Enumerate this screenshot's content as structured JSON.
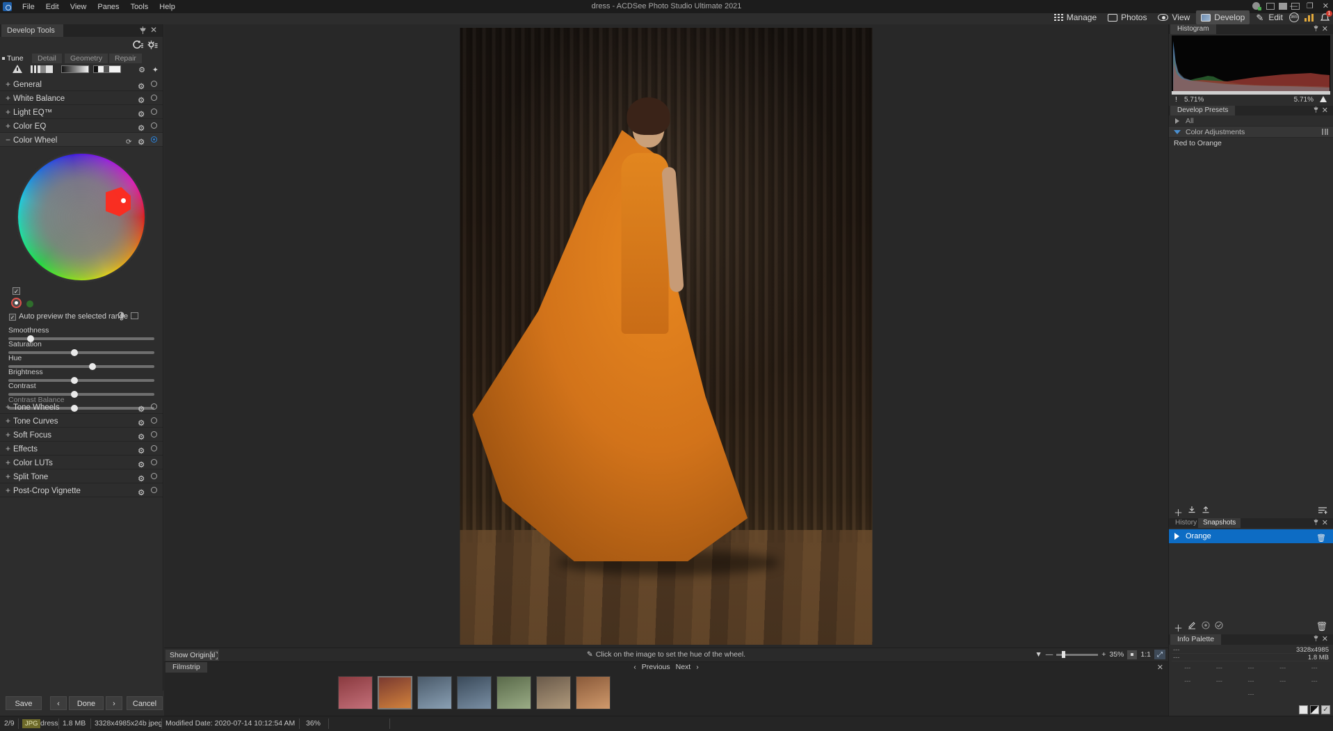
{
  "window": {
    "title": "dress - ACDSee Photo Studio Ultimate 2021",
    "minimize": "—",
    "maximize": "❐",
    "close": "✕"
  },
  "menu": {
    "items": [
      "File",
      "Edit",
      "View",
      "Panes",
      "Tools",
      "Help"
    ]
  },
  "modes": [
    {
      "label": "Manage",
      "icon": "grid-icon",
      "active": false
    },
    {
      "label": "Photos",
      "icon": "photos-icon",
      "active": false
    },
    {
      "label": "View",
      "icon": "eye-icon",
      "active": false
    },
    {
      "label": "Develop",
      "icon": "develop-icon",
      "active": true
    },
    {
      "label": "Edit",
      "icon": "edit-icon",
      "active": false
    }
  ],
  "mode_extras": {
    "badge_365": "365",
    "notifications": "1"
  },
  "left_panel": {
    "title": "Develop Tools",
    "pin": "📌",
    "close": "✕",
    "tabs": [
      {
        "label": "Tune",
        "active": true
      },
      {
        "label": "Detail",
        "active": false
      },
      {
        "label": "Geometry",
        "active": false
      },
      {
        "label": "Repair",
        "active": false
      }
    ],
    "tools": [
      {
        "label": "General",
        "expanded": false
      },
      {
        "label": "White Balance",
        "expanded": false
      },
      {
        "label": "Light EQ™",
        "expanded": false
      },
      {
        "label": "Color EQ",
        "expanded": false
      },
      {
        "label": "Color Wheel",
        "expanded": true
      },
      {
        "label": "Tone Wheels",
        "expanded": false
      },
      {
        "label": "Tone Curves",
        "expanded": false
      },
      {
        "label": "Soft Focus",
        "expanded": false
      },
      {
        "label": "Effects",
        "expanded": false
      },
      {
        "label": "Color LUTs",
        "expanded": false
      },
      {
        "label": "Split Tone",
        "expanded": false
      },
      {
        "label": "Post-Crop Vignette",
        "expanded": false
      }
    ],
    "color_wheel": {
      "auto_preview_label": "Auto preview the selected range",
      "auto_preview_checked": true,
      "range_checked": true,
      "sliders": [
        {
          "label": "Smoothness",
          "value": "20",
          "pos": 13,
          "dim": false
        },
        {
          "label": "Saturation",
          "value": "0",
          "pos": 43,
          "dim": false
        },
        {
          "label": "Hue",
          "value": "32",
          "pos": 55,
          "dim": false
        },
        {
          "label": "Brightness",
          "value": "0",
          "pos": 43,
          "dim": false
        },
        {
          "label": "Contrast",
          "value": "0",
          "pos": 43,
          "dim": false
        },
        {
          "label": "Contrast Balance",
          "value": "0",
          "pos": 43,
          "dim": true
        }
      ]
    }
  },
  "action_buttons": {
    "save": "Save",
    "prev": "‹",
    "done": "Done",
    "next": "›",
    "cancel": "Cancel"
  },
  "viewer": {
    "show_original": "Show Original",
    "hint": "Click on the image to set the hue of the wheel.",
    "zoom_value": "35%",
    "zoom_one_to_one": "1:1",
    "minus": "—",
    "plus": "+"
  },
  "filmstrip": {
    "title": "Filmstrip",
    "previous": "Previous",
    "next": "Next",
    "close": "✕",
    "thumbs": [
      {
        "selected": false,
        "c1": "#8a3a3f",
        "c2": "#c4707a"
      },
      {
        "selected": true,
        "c1": "#7a3a30",
        "c2": "#d2823c"
      },
      {
        "selected": false,
        "c1": "#4a5a6a",
        "c2": "#8aa0b4"
      },
      {
        "selected": false,
        "c1": "#3a4a5a",
        "c2": "#7a8fa4"
      },
      {
        "selected": false,
        "c1": "#5a6a4a",
        "c2": "#9aac86"
      },
      {
        "selected": false,
        "c1": "#6a5a4a",
        "c2": "#b09a7c"
      },
      {
        "selected": false,
        "c1": "#8a5a3a",
        "c2": "#d09a6c"
      }
    ]
  },
  "right_panel": {
    "histogram": {
      "title": "Histogram",
      "pin": "📌",
      "close": "✕",
      "left_stat": "5.71%",
      "right_stat": "5.71%",
      "warning_icon": "warning-triangle-icon"
    },
    "presets": {
      "title": "Develop Presets",
      "pin": "📌",
      "close": "✕",
      "groups": [
        {
          "label": "All",
          "expanded": false,
          "selected": false
        },
        {
          "label": "Color Adjustments",
          "expanded": true,
          "selected": true
        }
      ],
      "items": [
        "Red to Orange"
      ]
    },
    "snapshots": {
      "tabs": [
        {
          "label": "History",
          "active": false
        },
        {
          "label": "Snapshots",
          "active": true
        }
      ],
      "pin": "📌",
      "close": "✕",
      "toolbar_icons": [
        "add-icon",
        "import-icon",
        "export-icon",
        "list-options-icon"
      ],
      "items": [
        {
          "label": "Orange",
          "selected": true,
          "delete_icon": "trash-icon"
        }
      ]
    },
    "info_palette": {
      "title": "Info Palette",
      "pin": "📌",
      "close": "✕",
      "toolbar_icons": [
        "add-icon",
        "edit-icon",
        "target-icon",
        "check-icon",
        "trash-icon"
      ],
      "rows": [
        {
          "key": "---",
          "value": "3328x4985"
        },
        {
          "key": "---",
          "value": "1.8 MB"
        }
      ],
      "grid_placeholder": "---"
    }
  },
  "statusbar": {
    "counter": "2/9",
    "format": "JPG",
    "filename": "dress",
    "filesize": "1.8 MB",
    "dimensions": "3328x4985x24b jpeg",
    "modified": "Modified Date: 2020-07-14 10:12:54 AM",
    "zoom": "36%"
  },
  "colors": {
    "accent_blue": "#0d6cc4",
    "panel_bg": "#2d2d2d",
    "dark_bg": "#252525",
    "selection_orange": "#ff2a1c"
  }
}
